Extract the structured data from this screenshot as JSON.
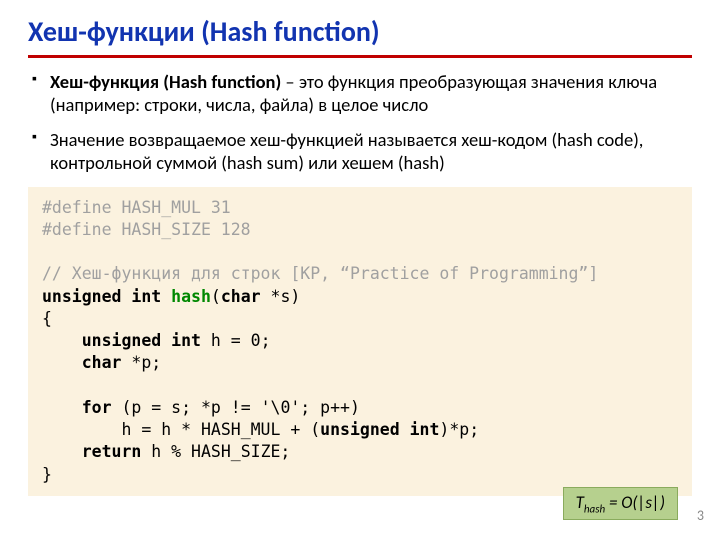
{
  "title": "Хеш-функции (Hash function)",
  "bullets": {
    "b1_bold": "Хеш-функция (Hash function)",
    "b1_rest": " – это функция преобразующая значения ключа (например: строки, числа, файла) в целое число",
    "b2": "Значение возвращаемое хеш-функцией называется хеш-кодом (hash code), контрольной суммой (hash sum) или хешем (hash)"
  },
  "code": {
    "l1": "#define HASH_MUL 31",
    "l2": "#define HASH_SIZE 128",
    "l3": "",
    "l4": "// Хеш-функция для строк [KP, “Practice of Programming”]",
    "l5_kw1": "unsigned int",
    "l5_fn": " hash",
    "l5_rest": "(",
    "l5_kw2": "char",
    "l5_rest2": " *s)",
    "l6": "{",
    "l7_indent": "    ",
    "l7_kw": "unsigned int",
    "l7_rest": " h = 0;",
    "l8_indent": "    ",
    "l8_kw": "char",
    "l8_rest": " *p;",
    "l9": "",
    "l10_indent": "    ",
    "l10_kw": "for",
    "l10_rest": " (p = s; *p != '\\0'; p++)",
    "l11_indent": "        ",
    "l11_rest1": "h = h * HASH_MUL + (",
    "l11_kw": "unsigned int",
    "l11_rest2": ")*p;",
    "l12_indent": "    ",
    "l12_kw": "return",
    "l12_rest": " h % HASH_SIZE;",
    "l13": "}"
  },
  "complexity": {
    "T": "T",
    "sub": "hash",
    "eq": " = O(|s|)"
  },
  "page": "3"
}
